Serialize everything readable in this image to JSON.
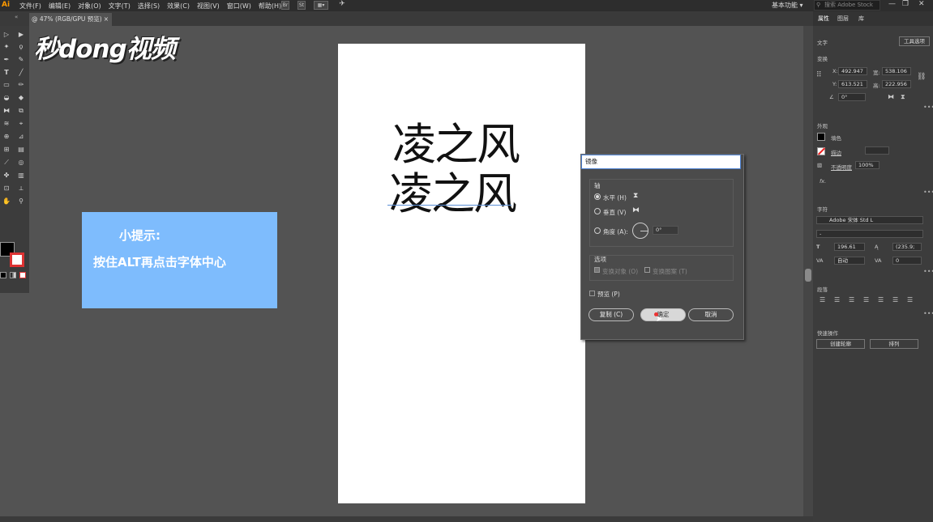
{
  "app": {
    "logo": "Ai",
    "menus": [
      "文件(F)",
      "编辑(E)",
      "对象(O)",
      "文字(T)",
      "选择(S)",
      "效果(C)",
      "视图(V)",
      "窗口(W)",
      "帮助(H)"
    ],
    "toolbar_icons": [
      "Br",
      "St"
    ],
    "workspace": "基本功能",
    "stock_search_placeholder": "搜索 Adobe Stock",
    "window_controls": [
      "—",
      "❐",
      "✕"
    ]
  },
  "document_tab": {
    "title": "@ 47% (RGB/GPU 预览)",
    "close": "×"
  },
  "canvas": {
    "text_lines": [
      "凌之风",
      "凌之风"
    ]
  },
  "watermark": "秒dong视频",
  "tip": {
    "title": "小提示:",
    "body": "按住ALT再点击字体中心"
  },
  "mirror_dialog": {
    "title": "镜像",
    "axis_label": "轴",
    "horizontal": "水平 (H)",
    "vertical": "垂直 (V)",
    "angle": "角度 (A):",
    "angle_value": "0°",
    "options_label": "选项",
    "transform_objects": "变换对象 (O)",
    "transform_patterns": "变换图案 (T)",
    "preview": "预览 (P)",
    "copy_button": "复制 (C)",
    "ok_button": "确定",
    "cancel_button": "取消"
  },
  "properties_panel": {
    "tabs": [
      "属性",
      "图层",
      "库"
    ],
    "type_label": "文字",
    "tool_options_button": "工具选项",
    "transform_label": "变换",
    "x_label": "X:",
    "x_value": "492.947",
    "y_label": "Y:",
    "y_value": "613.521",
    "w_label": "宽:",
    "w_value": "538.106",
    "h_label": "高:",
    "h_value": "222.956",
    "angle_value": "0°",
    "appearance_label": "外观",
    "fill_label": "填色",
    "stroke_label": "描边",
    "opacity_label": "不透明度",
    "opacity_value": "100%",
    "fx_label": "fx.",
    "character_label": "字符",
    "font_name": "Adobe 宋体 Std L",
    "font_style": "-",
    "font_size": "196.61",
    "leading": "(235.9;",
    "kerning": "自动",
    "tracking": "0",
    "paragraph_label": "段落",
    "quick_actions_label": "快速操作",
    "create_outlines_button": "创建轮廓",
    "arrange_button": "排列"
  }
}
